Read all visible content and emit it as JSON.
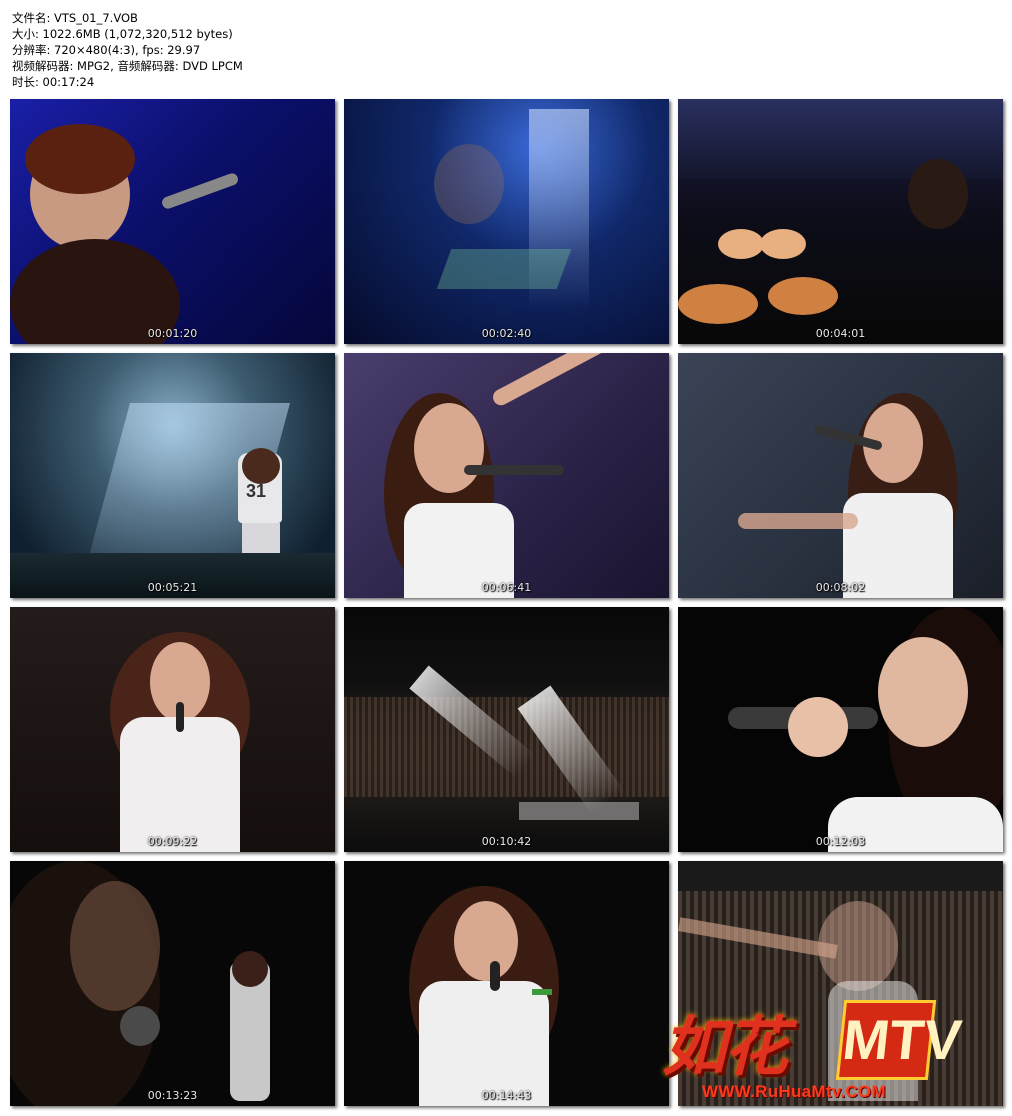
{
  "meta": {
    "filename": "文件名: VTS_01_7.VOB",
    "size": "大小: 1022.6MB (1,072,320,512 bytes)",
    "resolution": "分辨率: 720×480(4:3), fps: 29.97",
    "codec": "视频解码器: MPG2, 音频解码器: DVD LPCM",
    "duration": "时长: 00:17:24"
  },
  "thumbnails": [
    {
      "time": "00:01:20"
    },
    {
      "time": "00:02:40"
    },
    {
      "time": "00:04:01"
    },
    {
      "time": "00:05:21"
    },
    {
      "time": "00:06:41"
    },
    {
      "time": "00:08:02"
    },
    {
      "time": "00:09:22"
    },
    {
      "time": "00:10:42"
    },
    {
      "time": "00:12:03"
    },
    {
      "time": "00:13:23"
    },
    {
      "time": "00:14:43"
    },
    {
      "time": ""
    }
  ],
  "scene_texts": {
    "jersey_number": "31"
  },
  "watermark": {
    "name": "如花",
    "mtv": "MTV",
    "url": "WWW.RuHuaMtv.COM"
  }
}
